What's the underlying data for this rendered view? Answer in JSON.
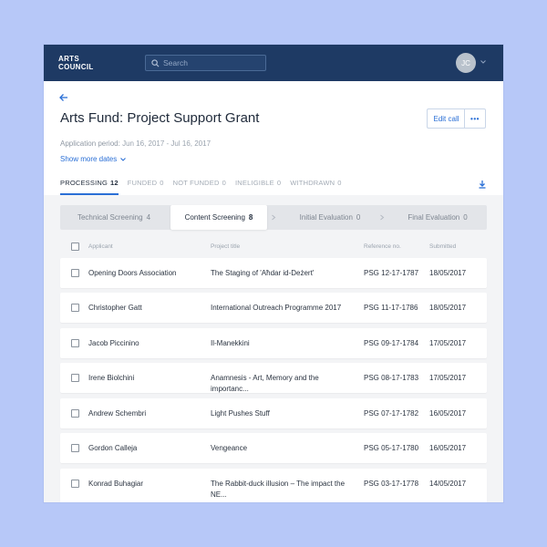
{
  "header": {
    "logo_line1": "ARTS",
    "logo_line2": "COUNCIL",
    "search_placeholder": "Search",
    "user_initials": "JC"
  },
  "page": {
    "title": "Arts Fund: Project Support Grant",
    "edit_label": "Edit call",
    "more_label": "•••",
    "period_label": "Application period:",
    "period_value": "Jun 16, 2017 - Jul 16, 2017",
    "show_more": "Show more dates"
  },
  "tabs": [
    {
      "label": "PROCESSING",
      "count": "12",
      "active": true
    },
    {
      "label": "FUNDED",
      "count": "0"
    },
    {
      "label": "NOT FUNDED",
      "count": "0"
    },
    {
      "label": "INELIGIBLE",
      "count": "0"
    },
    {
      "label": "WITHDRAWN",
      "count": "0"
    }
  ],
  "stages": [
    {
      "label": "Technical Screening",
      "count": "4"
    },
    {
      "label": "Content Screening",
      "count": "8",
      "active": true
    },
    {
      "label": "Initial Evaluation",
      "count": "0"
    },
    {
      "label": "Final Evaluation",
      "count": "0"
    }
  ],
  "table": {
    "columns": [
      "Applicant",
      "Project title",
      "Reference no.",
      "Submitted"
    ],
    "rows": [
      {
        "applicant": "Opening Doors Association",
        "title": "The Staging of 'Aħdar id-Deżert'",
        "ref": "PSG 12-17-1787",
        "submitted": "18/05/2017"
      },
      {
        "applicant": "Christopher Gatt",
        "title": "International Outreach Programme 2017",
        "ref": "PSG 11-17-1786",
        "submitted": "18/05/2017"
      },
      {
        "applicant": "Jacob Piccinino",
        "title": "Il-Manekkini",
        "ref": "PSG 09-17-1784",
        "submitted": "17/05/2017"
      },
      {
        "applicant": "Irene Biolchini",
        "title": "Anamnesis - Art, Memory and the importanc...",
        "ref": "PSG 08-17-1783",
        "submitted": "17/05/2017"
      },
      {
        "applicant": "Andrew Schembri",
        "title": "Light Pushes Stuff",
        "ref": "PSG 07-17-1782",
        "submitted": "16/05/2017"
      },
      {
        "applicant": "Gordon Calleja",
        "title": "Vengeance",
        "ref": "PSG 05-17-1780",
        "submitted": "16/05/2017"
      },
      {
        "applicant": "Konrad Buhagiar",
        "title": "The Rabbit-duck illusion – The impact the NE...",
        "ref": "PSG 03-17-1778",
        "submitted": "14/05/2017"
      }
    ]
  },
  "colors": {
    "header_bg": "#1e3a64",
    "accent": "#2a6fd6",
    "page_bg": "#b7c8f8"
  }
}
